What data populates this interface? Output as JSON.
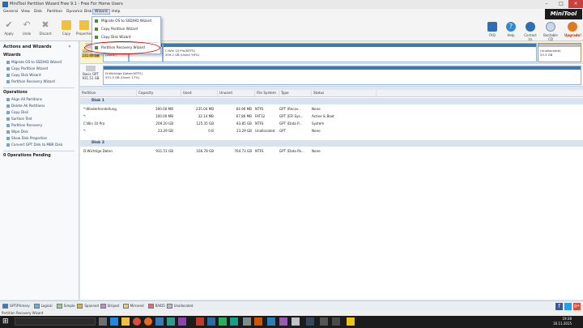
{
  "window": {
    "title": "MiniTool Partition Wizard Free 9.1 - Free For Home Users"
  },
  "menubar": [
    "General",
    "View",
    "Disk",
    "Partition",
    "Dynamic Disk",
    "Wizard",
    "Help"
  ],
  "toolbar": {
    "left": [
      "Apply",
      "Undo",
      "Discard",
      "Copy",
      "Properties"
    ],
    "right": [
      "FAQ",
      "Help",
      "Contact Us",
      "Bootable CD",
      "Upgrade!"
    ],
    "logo": "MiniTool"
  },
  "wizard_menu": {
    "items": [
      "Migrate OS to SSD/HD Wizard",
      "Copy Partition Wizard",
      "Copy Disk Wizard",
      "Partition Recovery Wizard"
    ]
  },
  "sidebar": {
    "title": "Actions and Wizards",
    "wizards_title": "Wizards",
    "wizards": [
      "Migrate OS to SSD/HD Wizard",
      "Copy Partition Wizard",
      "Copy Disk Wizard",
      "Partition Recovery Wizard"
    ],
    "operations_title": "Operations",
    "operations": [
      "Align All Partitions",
      "Delete All Partitions",
      "Copy Disk",
      "Surface Test",
      "Partition Recovery",
      "Wipe Disk",
      "Show Disk Properties",
      "Convert GPT Disk to MBR Disk"
    ],
    "pending": "0 Operations Pending"
  },
  "diskmap": {
    "disk1": {
      "type": "Basic GPT",
      "size": "232.89 GB",
      "parts": [
        "300 MB (Used:)",
        "100 MB (Used:",
        "C:Win 10 Pro(NTFS)\n209.2 GB (Used: 59%)",
        "(Unallocated)\n23.3 GB"
      ]
    },
    "disk2": {
      "type": "Basic GPT",
      "size": "931.51 GB",
      "parts": [
        "D:Wichtige Daten(NTFS)\n931.5 GB (Used: 17%)"
      ]
    }
  },
  "table": {
    "headers": [
      "Partition",
      "Capacity",
      "Used",
      "Unused",
      "File System",
      "Type",
      "Status"
    ],
    "disk1_label": "Disk 1",
    "disk1_rows": [
      [
        "*:Wiederherstellung",
        "300.00 MB",
        "235.04 MB",
        "64.96 MB",
        "NTFS",
        "GPT (Recov...",
        "None"
      ],
      [
        "*:",
        "100.00 MB",
        "32.14 MB",
        "67.86 MB",
        "FAT32",
        "GPT (EFI Sys...",
        "Active & Boot"
      ],
      [
        "C:Win 10 Pro",
        "209.20 GB",
        "125.35 GB",
        "83.85 GB",
        "NTFS",
        "GPT (Data P...",
        "System"
      ],
      [
        "*:",
        "23.29 GB",
        "0 B",
        "23.29 GB",
        "Unallocated",
        "GPT",
        "None"
      ]
    ],
    "disk2_label": "Disk 2",
    "disk2_rows": [
      [
        "D:Wichtige Daten",
        "931.51 GB",
        "166.78 GB",
        "764.73 GB",
        "NTFS",
        "GPT (Data Pa...",
        "None"
      ]
    ]
  },
  "legend": [
    "GPT/Primary",
    "Logical",
    "Simple",
    "Spanned",
    "Striped",
    "Mirrored",
    "RAID5",
    "Unallocated"
  ],
  "legend_colors": [
    "#3b78b8",
    "#5fb3e0",
    "#9ad08a",
    "#d9b64c",
    "#b58fd0",
    "#e0d070",
    "#e07070",
    "#bdbdbd"
  ],
  "statusbar": "Partition Recovery Wizard",
  "clock": {
    "time": "19:38",
    "date": "16.11.2015"
  }
}
